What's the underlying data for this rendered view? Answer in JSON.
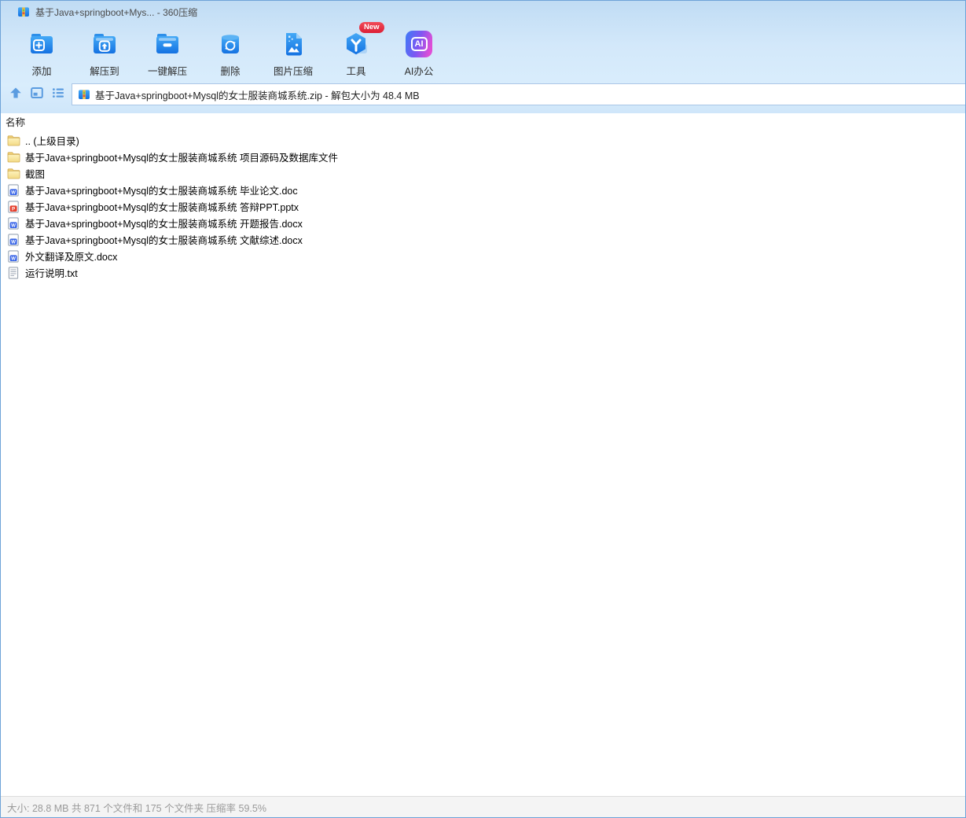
{
  "window": {
    "title": "基于Java+springboot+Mys... - 360压缩",
    "app_name": "360压缩"
  },
  "toolbar": {
    "items": [
      {
        "label": "添加",
        "icon": "add-archive-icon"
      },
      {
        "label": "解压到",
        "icon": "extract-to-icon"
      },
      {
        "label": "一键解压",
        "icon": "one-click-extract-icon"
      },
      {
        "label": "删除",
        "icon": "delete-trash-icon"
      },
      {
        "label": "图片压缩",
        "icon": "image-compress-icon"
      },
      {
        "label": "工具",
        "icon": "tools-cube-icon",
        "badge": "New"
      },
      {
        "label": "AI办公",
        "icon": "ai-office-icon",
        "icon_text": "AI"
      }
    ]
  },
  "address_bar": {
    "path": "基于Java+springboot+Mysql的女士服装商城系统.zip - 解包大小为 48.4 MB"
  },
  "file_list": {
    "name_column_header": "名称",
    "badge_word": "W",
    "badge_ppt": "P",
    "files": [
      {
        "name": ".. (上级目录)",
        "type": "folder"
      },
      {
        "name": "基于Java+springboot+Mysql的女士服装商城系统 项目源码及数据库文件",
        "type": "folder"
      },
      {
        "name": "截图",
        "type": "folder"
      },
      {
        "name": "基于Java+springboot+Mysql的女士服装商城系统 毕业论文.doc",
        "type": "word"
      },
      {
        "name": "基于Java+springboot+Mysql的女士服装商城系统 答辩PPT.pptx",
        "type": "ppt"
      },
      {
        "name": "基于Java+springboot+Mysql的女士服装商城系统 开题报告.docx",
        "type": "word"
      },
      {
        "name": "基于Java+springboot+Mysql的女士服装商城系统 文献综述.docx",
        "type": "word"
      },
      {
        "name": "外文翻译及原文.docx",
        "type": "word"
      },
      {
        "name": "运行说明.txt",
        "type": "txt"
      }
    ]
  },
  "status_bar": {
    "text": "大小: 28.8 MB 共 871 个文件和 175 个文件夹 压缩率 59.5%"
  },
  "colors": {
    "accent_blue": "#1d7ce6",
    "chrome_blue": "#d3e8fa",
    "folder_yellow": "#f5dd8d",
    "word_blue": "#3a66e8",
    "ppt_red": "#e5402e",
    "new_badge_red": "#dc1f36",
    "status_text_gray": "#9a9a9a"
  }
}
